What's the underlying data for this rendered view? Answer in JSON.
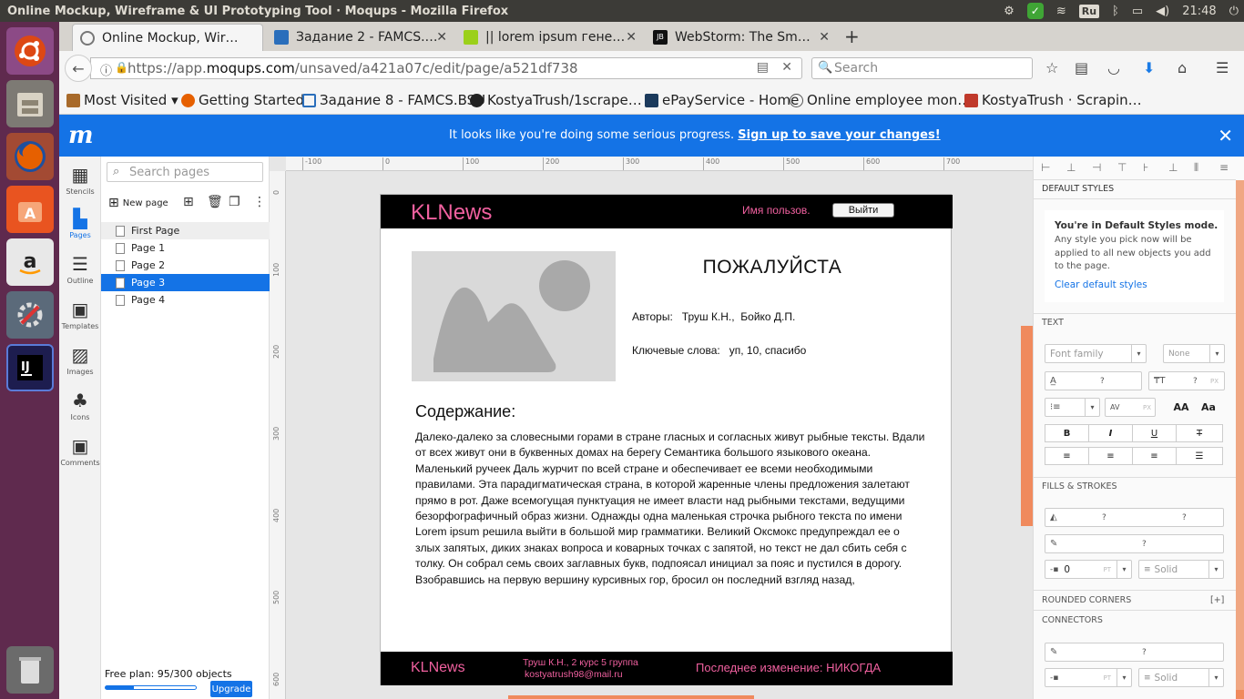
{
  "system": {
    "window_title": "Online Mockup, Wireframe & UI Prototyping Tool · Moqups - Mozilla Firefox",
    "lang": "Ru",
    "time": "21:48"
  },
  "tabs": [
    {
      "title": "Online Mockup, Wir…",
      "fav": "#7a7a7a"
    },
    {
      "title": "Задание 2 - FAMCS.…",
      "fav": "#2a6ebb"
    },
    {
      "title": "|| lorem ipsum гене…",
      "fav": "#9bd01a"
    },
    {
      "title": "WebStorm: The Sm…",
      "fav": "#111111"
    }
  ],
  "nav": {
    "url_prefix": "https://app.",
    "url_host": "moqups.com",
    "url_path": "/unsaved/a421a07c/edit/page/a521df738",
    "search_placeholder": "Search"
  },
  "bookmarks": [
    {
      "label": "Most Visited ▾",
      "fav": "#a86a2a"
    },
    {
      "label": "Getting Started",
      "fav": "#e66000"
    },
    {
      "label": "Задание 8 - FAMCS.BSU",
      "fav": "#2a6ebb"
    },
    {
      "label": "KostyaTrush/1scrape…",
      "fav": "#222222"
    },
    {
      "label": "ePayService - Home",
      "fav": "#1b3a5c"
    },
    {
      "label": "Online employee mon…",
      "fav": "#555555"
    },
    {
      "label": "KostyaTrush · Scrapin…",
      "fav": "#c0392b"
    }
  ],
  "banner": {
    "logo": "m",
    "message": "It looks like you're doing some serious progress.",
    "link": "Sign up to save your changes!"
  },
  "rail": [
    {
      "label": "Stencils"
    },
    {
      "label": "Pages"
    },
    {
      "label": "Outline"
    },
    {
      "label": "Templates"
    },
    {
      "label": "Images"
    },
    {
      "label": "Icons"
    },
    {
      "label": "Comments"
    }
  ],
  "pages_panel": {
    "search_placeholder": "Search pages",
    "new_page": "New page",
    "pages": [
      "First Page",
      "Page 1",
      "Page 2",
      "Page 3",
      "Page 4"
    ],
    "selected": "Page 3",
    "free_plan": "Free plan: 95/300 objects",
    "plan_used_fraction": 0.317,
    "upgrade": "Upgrade"
  },
  "ruler": {
    "h": [
      "-100",
      "0",
      "100",
      "200",
      "300",
      "400",
      "500",
      "600",
      "700"
    ],
    "v": [
      "0",
      "100",
      "200",
      "300",
      "400",
      "500",
      "600"
    ]
  },
  "mockup": {
    "logo": "KLNews",
    "username": "Имя пользов.",
    "logout": "Выйти",
    "title": "ПОЖАЛУЙСТА",
    "authors": "Авторы:   Труш К.Н.,  Бойко Д.П.",
    "keywords": "Ключевые слова:   уп, 10, спасибо",
    "contents_heading": "Содержание:",
    "body": "Далеко-далеко за словесными горами в стране гласных и согласных живут  рыбные тексты. Вдали от всех живут они в буквенных домах на берегу  Семантика большого языкового океана. Маленький ручеек Даль журчит по  всей стране и обеспечивает ее всеми необходимыми правилами. Эта  парадигматическая страна, в которой жаренные члены предложения залетают  прямо в рот. Даже всемогущая пунктуация не имеет власти над рыбными  текстами, ведущими безорфографичный образ жизни. Однажды одна маленькая  строчка рыбного текста по имени Lorem ipsum решила выйти в большой мир  грамматики. Великий Оксмокс предупреждал ее о злых запятых, диких знаках  вопроса и коварных точках с запятой, но текст не дал сбить себя с  толку. Он собрал семь своих заглавных букв, подпоясал инициал за пояс и  пустился в дорогу. Взобравшись на первую вершину курсивных гор, бросил  он последний взгляд назад,",
    "footer_logo": "KLNews",
    "footer_author_line1": "Труш К.Н., 2 курс 5 группа",
    "footer_author_line2": "kostyatrush98@mail.ru",
    "footer_modified": "Последнее изменение: НИКОГДА"
  },
  "right_panel": {
    "default_styles_header": "DEFAULT STYLES",
    "default_mode_title": "You're in Default Styles mode.",
    "default_mode_text": "Any style you pick now will be applied to all new objects you add to the page.",
    "clear_default": "Clear default styles",
    "text_header": "TEXT",
    "font_family_placeholder": "Font family",
    "font_weight": "None",
    "q": "?",
    "unit_px": "PX",
    "unit_pt": "PT",
    "fmt_bold": "B",
    "fmt_italic": "I",
    "fmt_underline": "U",
    "fmt_strike": "T",
    "case_upper": "AA",
    "case_cap": "Aa",
    "fills_header": "FILLS & STROKES",
    "stroke_width": "0",
    "stroke_style": "Solid",
    "rounded_header": "ROUNDED CORNERS",
    "rounded_toggle": "[+]",
    "connectors_header": "CONNECTORS",
    "connector_style": "Solid"
  },
  "colors": {
    "accent": "#1473e6",
    "mock_pink": "#f0609f",
    "scroll_orange": "#f08a5d"
  }
}
